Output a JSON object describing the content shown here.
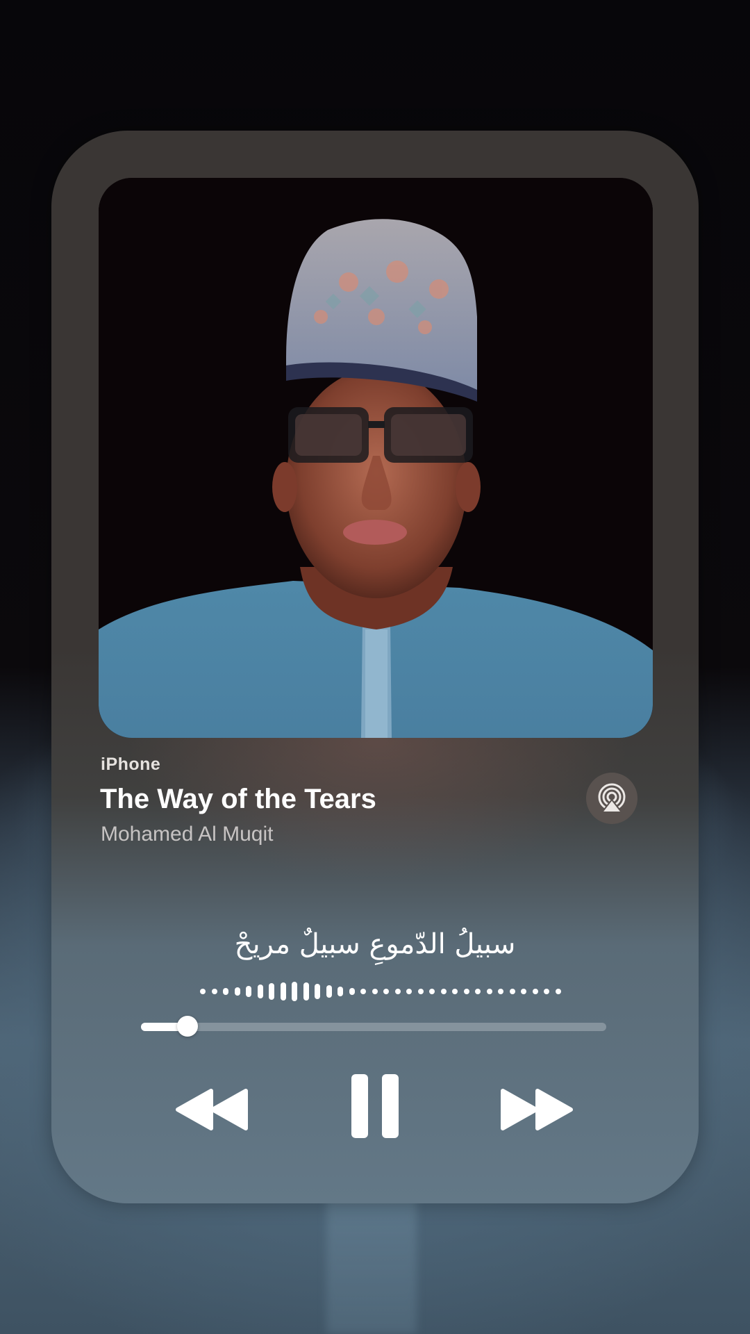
{
  "now_playing": {
    "device": "iPhone",
    "title": "The Way of the Tears",
    "artist": "Mohamed Al Muqit",
    "lyric_line": "سبيلُ الدّموعِ سبيلٌ مريحْ"
  },
  "artwork": {
    "icon": "album-artwork-portrait"
  },
  "playback": {
    "progress_fraction": 0.1,
    "state": "playing"
  },
  "controls": {
    "rewind_icon": "rewind-icon",
    "pause_icon": "pause-icon",
    "fast_forward_icon": "fast-forward-icon",
    "airplay_icon": "airplay-icon"
  },
  "colors": {
    "accent": "#ffffff",
    "card_top": "#3a3634",
    "card_bottom": "#637887"
  }
}
